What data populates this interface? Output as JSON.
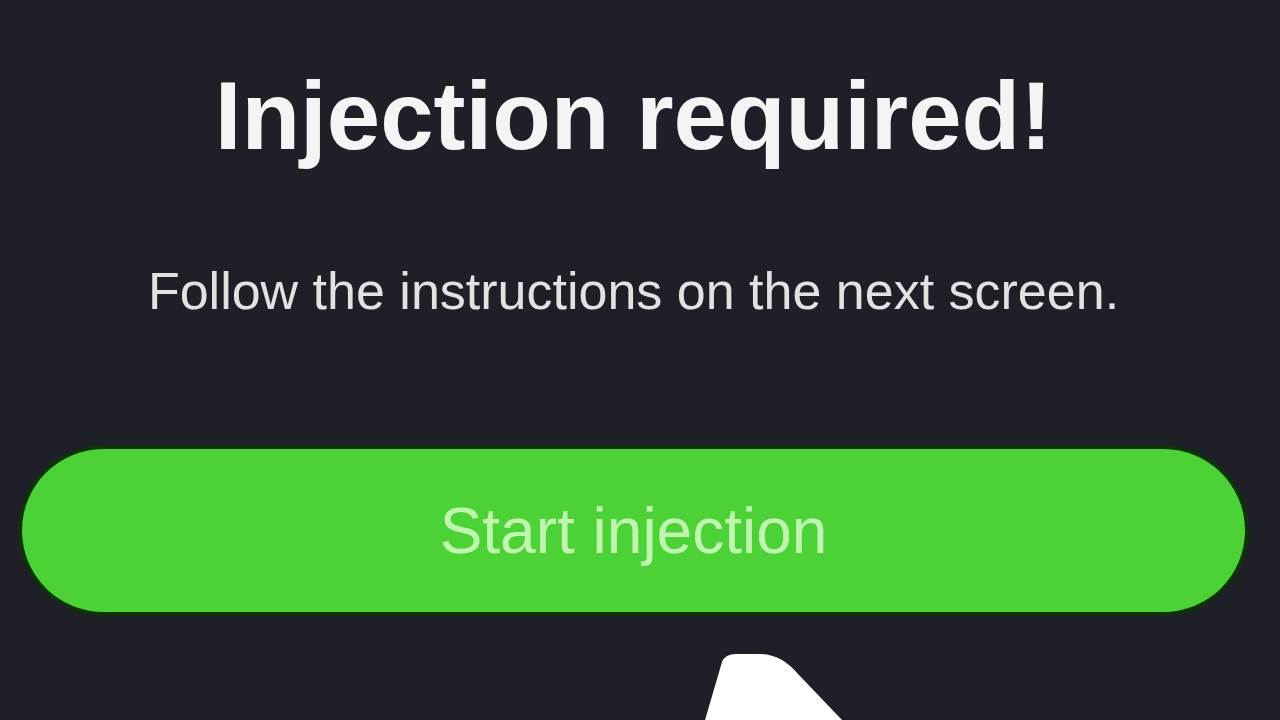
{
  "title": "Injection required!",
  "message": "Follow the instructions on the next screen.",
  "button": {
    "label": "Start injection"
  }
}
